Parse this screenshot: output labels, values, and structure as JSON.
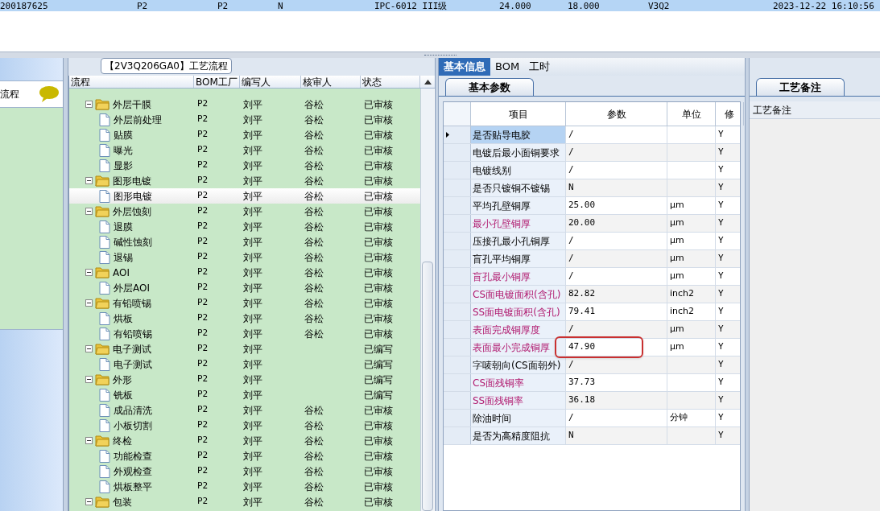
{
  "top_row": {
    "cells": [
      "200187625",
      "P2",
      "P2",
      "N",
      "IPC-6012 III级",
      "24.000",
      "18.000",
      "V3Q2",
      "2023-12-22 16:10:56"
    ]
  },
  "left_panel": {
    "tab": {
      "label": "流程"
    }
  },
  "process_panel": {
    "title": "【2V3Q206GA0】工艺流程",
    "columns": [
      "流程",
      "BOM工厂",
      "编写人",
      "核审人",
      "状态"
    ],
    "tree": [
      {
        "name": "外层干膜",
        "factory": "P2",
        "writer": "刘平",
        "reviewer": "谷松",
        "status": "已审核",
        "expanded": true,
        "selected": false,
        "children": [
          {
            "name": "外层前处理",
            "factory": "P2",
            "writer": "刘平",
            "reviewer": "谷松",
            "status": "已审核",
            "selected": false
          },
          {
            "name": "贴膜",
            "factory": "P2",
            "writer": "刘平",
            "reviewer": "谷松",
            "status": "已审核",
            "selected": false
          },
          {
            "name": "曝光",
            "factory": "P2",
            "writer": "刘平",
            "reviewer": "谷松",
            "status": "已审核",
            "selected": false
          },
          {
            "name": "显影",
            "factory": "P2",
            "writer": "刘平",
            "reviewer": "谷松",
            "status": "已审核",
            "selected": false
          }
        ]
      },
      {
        "name": "图形电镀",
        "factory": "P2",
        "writer": "刘平",
        "reviewer": "谷松",
        "status": "已审核",
        "expanded": true,
        "selected": false,
        "children": [
          {
            "name": "图形电镀",
            "factory": "P2",
            "writer": "刘平",
            "reviewer": "谷松",
            "status": "已审核",
            "selected": true
          }
        ]
      },
      {
        "name": "外层蚀刻",
        "factory": "P2",
        "writer": "刘平",
        "reviewer": "谷松",
        "status": "已审核",
        "expanded": true,
        "selected": false,
        "children": [
          {
            "name": "退膜",
            "factory": "P2",
            "writer": "刘平",
            "reviewer": "谷松",
            "status": "已审核",
            "selected": false
          },
          {
            "name": "碱性蚀刻",
            "factory": "P2",
            "writer": "刘平",
            "reviewer": "谷松",
            "status": "已审核",
            "selected": false
          },
          {
            "name": "退锡",
            "factory": "P2",
            "writer": "刘平",
            "reviewer": "谷松",
            "status": "已审核",
            "selected": false
          }
        ]
      },
      {
        "name": "AOI",
        "factory": "P2",
        "writer": "刘平",
        "reviewer": "谷松",
        "status": "已审核",
        "expanded": true,
        "selected": false,
        "children": [
          {
            "name": "外层AOI",
            "factory": "P2",
            "writer": "刘平",
            "reviewer": "谷松",
            "status": "已审核",
            "selected": false
          }
        ]
      },
      {
        "name": "有铅喷锡",
        "factory": "P2",
        "writer": "刘平",
        "reviewer": "谷松",
        "status": "已审核",
        "expanded": true,
        "selected": false,
        "children": [
          {
            "name": "烘板",
            "factory": "P2",
            "writer": "刘平",
            "reviewer": "谷松",
            "status": "已审核",
            "selected": false
          },
          {
            "name": "有铅喷锡",
            "factory": "P2",
            "writer": "刘平",
            "reviewer": "谷松",
            "status": "已审核",
            "selected": false
          }
        ]
      },
      {
        "name": "电子测试",
        "factory": "P2",
        "writer": "刘平",
        "status": "已编写",
        "expanded": true,
        "selected": false,
        "children": [
          {
            "name": "电子测试",
            "factory": "P2",
            "writer": "刘平",
            "status": "已编写",
            "selected": false
          }
        ]
      },
      {
        "name": "外形",
        "factory": "P2",
        "writer": "刘平",
        "status": "已编写",
        "expanded": true,
        "selected": false,
        "children": [
          {
            "name": "铣板",
            "factory": "P2",
            "writer": "刘平",
            "status": "已编写",
            "selected": false
          },
          {
            "name": "成品清洗",
            "factory": "P2",
            "writer": "刘平",
            "reviewer": "谷松",
            "status": "已审核",
            "selected": false
          },
          {
            "name": "小板切割",
            "factory": "P2",
            "writer": "刘平",
            "reviewer": "谷松",
            "status": "已审核",
            "selected": false
          }
        ]
      },
      {
        "name": "终检",
        "factory": "P2",
        "writer": "刘平",
        "reviewer": "谷松",
        "status": "已审核",
        "expanded": true,
        "selected": false,
        "children": [
          {
            "name": "功能检查",
            "factory": "P2",
            "writer": "刘平",
            "reviewer": "谷松",
            "status": "已审核",
            "selected": false
          },
          {
            "name": "外观检查",
            "factory": "P2",
            "writer": "刘平",
            "reviewer": "谷松",
            "status": "已审核",
            "selected": false
          },
          {
            "name": "烘板整平",
            "factory": "P2",
            "writer": "刘平",
            "reviewer": "谷松",
            "status": "已审核",
            "selected": false
          }
        ]
      },
      {
        "name": "包装",
        "factory": "P2",
        "writer": "刘平",
        "reviewer": "谷松",
        "status": "已审核",
        "expanded": true,
        "selected": false
      }
    ]
  },
  "detail_panel": {
    "tabs": [
      {
        "label": "基本信息",
        "selected": true
      },
      {
        "label": "BOM",
        "selected": false
      },
      {
        "label": "工时",
        "selected": false
      }
    ],
    "sub_tab": {
      "label": "基本参数"
    },
    "columns": [
      "项目",
      "参数",
      "单位",
      "修"
    ],
    "rows": [
      {
        "item": "是否贴导电胶",
        "value": "/",
        "modified": "Y",
        "emphasized": false,
        "selected": true,
        "circled": false
      },
      {
        "item": "电镀后最小面铜要求",
        "value": "/",
        "modified": "Y",
        "emphasized": false,
        "selected": false,
        "circled": false
      },
      {
        "item": "电镀线别",
        "value": "/",
        "modified": "Y",
        "emphasized": false,
        "selected": false,
        "circled": false
      },
      {
        "item": "是否只镀铜不镀锡",
        "value": "N",
        "modified": "Y",
        "emphasized": false,
        "selected": false,
        "circled": false
      },
      {
        "item": "平均孔壁铜厚",
        "value": "25.00",
        "unit": "μm",
        "modified": "Y",
        "emphasized": false,
        "selected": false,
        "circled": false
      },
      {
        "item": "最小孔壁铜厚",
        "value": "20.00",
        "unit": "μm",
        "modified": "Y",
        "emphasized": true,
        "selected": false,
        "circled": false
      },
      {
        "item": "压接孔最小孔铜厚",
        "value": "/",
        "unit": "μm",
        "modified": "Y",
        "emphasized": false,
        "selected": false,
        "circled": false
      },
      {
        "item": "盲孔平均铜厚",
        "value": "/",
        "unit": "μm",
        "modified": "Y",
        "emphasized": false,
        "selected": false,
        "circled": false
      },
      {
        "item": "盲孔最小铜厚",
        "value": "/",
        "unit": "μm",
        "modified": "Y",
        "emphasized": true,
        "selected": false,
        "circled": false
      },
      {
        "item": "CS面电镀面积(含孔)",
        "value": "82.82",
        "unit": "inch2",
        "modified": "Y",
        "emphasized": true,
        "selected": false,
        "circled": false
      },
      {
        "item": "SS面电镀面积(含孔)",
        "value": "79.41",
        "unit": "inch2",
        "modified": "Y",
        "emphasized": true,
        "selected": false,
        "circled": false
      },
      {
        "item": "表面完成铜厚度",
        "value": "/",
        "unit": "μm",
        "modified": "Y",
        "emphasized": true,
        "selected": false,
        "circled": false
      },
      {
        "item": "表面最小完成铜厚",
        "value": "47.90",
        "unit": "μm",
        "modified": "Y",
        "emphasized": true,
        "selected": false,
        "circled": true
      },
      {
        "item": "字唛朝向(CS面朝外)",
        "value": "/",
        "modified": "Y",
        "emphasized": false,
        "selected": false,
        "circled": false
      },
      {
        "item": "CS面残铜率",
        "value": "37.73",
        "modified": "Y",
        "emphasized": true,
        "selected": false,
        "circled": false
      },
      {
        "item": "SS面残铜率",
        "value": "36.18",
        "modified": "Y",
        "emphasized": true,
        "selected": false,
        "circled": false
      },
      {
        "item": "除油时间",
        "value": "/",
        "unit": "分钟",
        "modified": "Y",
        "emphasized": false,
        "selected": false,
        "circled": false
      },
      {
        "item": "是否为高精度阻抗",
        "value": "N",
        "modified": "Y",
        "emphasized": false,
        "selected": false,
        "circled": false
      }
    ]
  },
  "notes_panel": {
    "tab": {
      "label": "工艺备注"
    },
    "column": "工艺备注"
  }
}
